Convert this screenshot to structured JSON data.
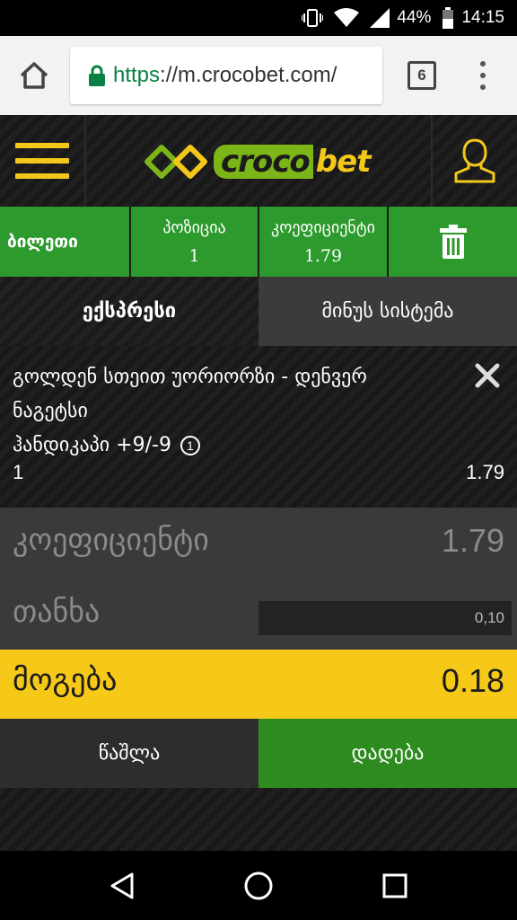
{
  "status_bar": {
    "battery": "44%",
    "time": "14:15"
  },
  "browser": {
    "url_scheme": "https",
    "url_rest": "://m.crocobet.com/",
    "tab_count": "6"
  },
  "header": {
    "logo_part1": "croco",
    "logo_part2": "bet"
  },
  "ticket_bar": {
    "title": "ბილეთი",
    "position_label": "პოზიცია",
    "position_value": "1",
    "coef_label": "კოეფიციენტი",
    "coef_value": "1.79"
  },
  "bet_tabs": {
    "express": "ექსპრესი",
    "minus_system": "მინუს სისტემა"
  },
  "bet_item": {
    "event": "გოლდენ სთეით უორიორზი - დენვერ ნაგეტსი",
    "market": "ჰანდიკაპი +9/-9",
    "pick": "1",
    "odd": "1.79"
  },
  "summary": {
    "coef_label": "კოეფიციენტი",
    "coef_value": "1.79",
    "stake_label": "თანხა",
    "stake_value": "0,10",
    "win_label": "მოგება",
    "win_value": "0.18"
  },
  "actions": {
    "clear": "წაშლა",
    "place": "დადება"
  },
  "colors": {
    "green": "#2c9a2c",
    "yellow": "#f6c918",
    "dark": "#1b1b1b"
  }
}
